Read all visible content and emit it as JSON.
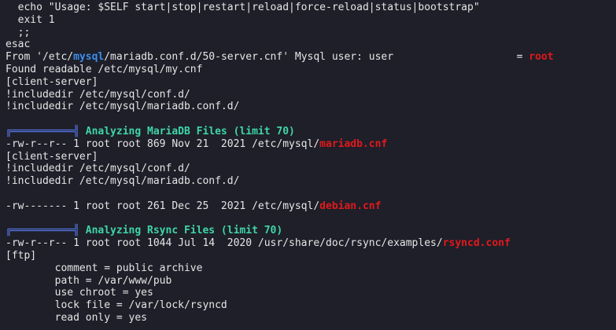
{
  "colors": {
    "background": "#1e1f29",
    "text": "#e6e6e6",
    "highlight_blue": "#3b8eea",
    "highlight_red": "#e0191c",
    "section_title": "#3fd5a8",
    "section_frame": "#5b7cf0"
  },
  "lines": [
    {
      "segments": [
        {
          "t": "  echo \"Usage: $SELF start|stop|restart|reload|force-reload|status|bootstrap\""
        }
      ]
    },
    {
      "segments": [
        {
          "t": "  exit 1"
        }
      ]
    },
    {
      "segments": [
        {
          "t": "  ;;"
        }
      ]
    },
    {
      "segments": [
        {
          "t": "esac"
        }
      ]
    },
    {
      "segments": [
        {
          "t": "From '/etc/"
        },
        {
          "t": "mysql",
          "s": "blue"
        },
        {
          "t": "/mariadb.conf.d/50-server.cnf' Mysql user: user                    = "
        },
        {
          "t": "root",
          "s": "red"
        }
      ]
    },
    {
      "segments": [
        {
          "t": "Found readable /etc/mysql/my.cnf"
        }
      ]
    },
    {
      "segments": [
        {
          "t": "[client-server]"
        }
      ]
    },
    {
      "segments": [
        {
          "t": "!includedir /etc/mysql/conf.d/"
        }
      ]
    },
    {
      "segments": [
        {
          "t": "!includedir /etc/mysql/mariadb.conf.d/"
        }
      ]
    },
    {
      "segments": [
        {
          "t": ""
        }
      ]
    },
    {
      "segments": [
        {
          "t": "╔══════════╣ ",
          "s": "frame"
        },
        {
          "t": "Analyzing MariaDB Files (limit 70)",
          "s": "green"
        }
      ]
    },
    {
      "segments": [
        {
          "t": "-rw-r--r-- 1 root root 869 Nov 21  2021 /etc/mysql/"
        },
        {
          "t": "mariadb.cnf",
          "s": "red"
        }
      ]
    },
    {
      "segments": [
        {
          "t": "[client-server]"
        }
      ]
    },
    {
      "segments": [
        {
          "t": "!includedir /etc/mysql/conf.d/"
        }
      ]
    },
    {
      "segments": [
        {
          "t": "!includedir /etc/mysql/mariadb.conf.d/"
        }
      ]
    },
    {
      "segments": [
        {
          "t": ""
        }
      ]
    },
    {
      "segments": [
        {
          "t": "-rw------- 1 root root 261 Dec 25  2021 /etc/mysql/"
        },
        {
          "t": "debian.cnf",
          "s": "red"
        }
      ]
    },
    {
      "segments": [
        {
          "t": ""
        }
      ]
    },
    {
      "segments": [
        {
          "t": "╔══════════╣ ",
          "s": "frame"
        },
        {
          "t": "Analyzing Rsync Files (limit 70)",
          "s": "green"
        }
      ]
    },
    {
      "segments": [
        {
          "t": "-rw-r--r-- 1 root root 1044 Jul 14  2020 /usr/share/doc/rsync/examples/"
        },
        {
          "t": "rsyncd.conf",
          "s": "red"
        }
      ]
    },
    {
      "segments": [
        {
          "t": "[ftp]"
        }
      ]
    },
    {
      "segments": [
        {
          "t": "        comment = public archive"
        }
      ]
    },
    {
      "segments": [
        {
          "t": "        path = /var/www/pub"
        }
      ]
    },
    {
      "segments": [
        {
          "t": "        use chroot = yes"
        }
      ]
    },
    {
      "segments": [
        {
          "t": "        lock file = /var/lock/rsyncd"
        }
      ]
    },
    {
      "segments": [
        {
          "t": "        read only = yes"
        }
      ]
    }
  ]
}
